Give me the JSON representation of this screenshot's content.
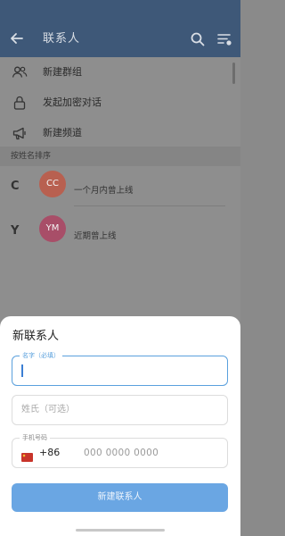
{
  "header": {
    "title": "联系人",
    "back_icon": "arrow-left-icon",
    "search_icon": "search-icon",
    "sort_icon": "sort-icon"
  },
  "menu": [
    {
      "label": "新建群组",
      "icon": "group-icon"
    },
    {
      "label": "发起加密对话",
      "icon": "lock-icon"
    },
    {
      "label": "新建频道",
      "icon": "megaphone-icon"
    }
  ],
  "section_header": "按姓名排序",
  "contacts": [
    {
      "letter": "C",
      "initials": "CC",
      "status": "一个月内曾上线",
      "color": "#b86050"
    },
    {
      "letter": "Y",
      "initials": "YM",
      "status": "近期曾上线",
      "color": "#a84e68"
    }
  ],
  "sheet": {
    "title": "新联系人",
    "first_name_label": "名字（必填）",
    "last_name_placeholder": "姓氏（可选）",
    "phone_label": "手机号码",
    "country_code": "+86",
    "phone_placeholder": "000 0000 0000",
    "submit_label": "新建联系人"
  },
  "colors": {
    "header_bg": "#3e5878",
    "accent": "#5aa0dd",
    "button": "#6aa6e3"
  }
}
